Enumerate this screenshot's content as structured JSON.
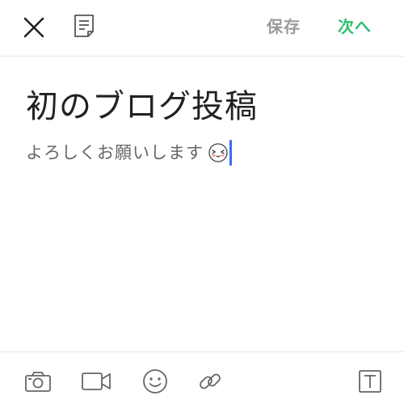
{
  "header": {
    "save_label": "保存",
    "next_label": "次へ",
    "close_icon": "close-icon",
    "document_icon": "document-icon",
    "accent_color": "#2fbf71"
  },
  "editor": {
    "title": "初のブログ投稿",
    "body": "よろしくお願いします",
    "sticker_icon": "sticker-face-icon",
    "caret_color": "#3a6df0"
  },
  "toolbar": {
    "items": [
      {
        "icon": "camera-icon"
      },
      {
        "icon": "video-icon"
      },
      {
        "icon": "emoji-icon"
      },
      {
        "icon": "link-icon"
      },
      {
        "icon": "text-format-icon"
      }
    ]
  }
}
